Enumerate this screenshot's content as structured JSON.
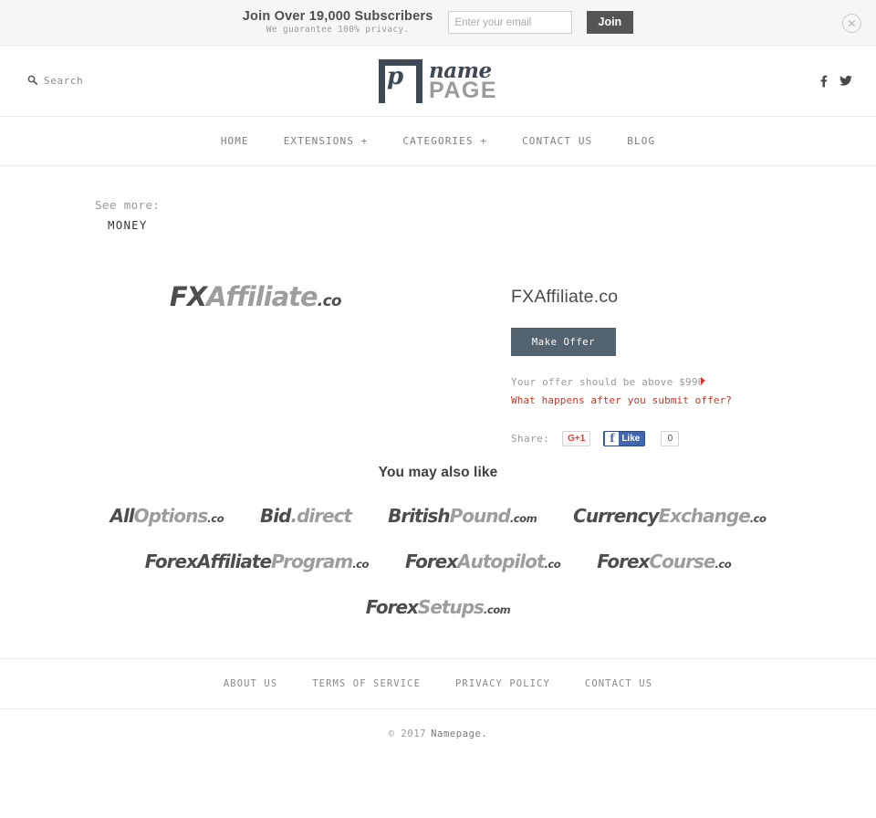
{
  "subscribe_bar": {
    "title": "Join Over 19,000 Subscribers",
    "subtitle": "We guarantee 100% privacy.",
    "email_placeholder": "Enter your email",
    "email_value": "",
    "join_label": "Join",
    "close_icon": "close-circle-icon"
  },
  "header": {
    "search_label": "Search",
    "search_icon": "search-icon",
    "logo_name": "name",
    "logo_page": "PAGE",
    "logo_mark_letter": "p",
    "social": [
      {
        "name": "facebook-icon",
        "label": "f"
      },
      {
        "name": "twitter-icon",
        "label": "t"
      }
    ]
  },
  "nav": {
    "items": [
      {
        "label": "HOME"
      },
      {
        "label": "EXTENSIONS +"
      },
      {
        "label": "CATEGORIES +"
      },
      {
        "label": "CONTACT US"
      },
      {
        "label": "BLOG"
      }
    ]
  },
  "breadcrumb": {
    "label": "See more:",
    "category": "MONEY"
  },
  "product": {
    "wordmark": {
      "part1": "FX",
      "part2": "Affiliate",
      "tld": ".co"
    },
    "title": "FXAffiliate.co",
    "make_offer_label": "Make Offer",
    "offer_note": "Your offer should be above $990",
    "minimum_offer": "$990",
    "offer_link": "What happens after you submit offer?",
    "share_label": "Share:",
    "gplus_label": "G+1",
    "fb_like_label": "Like",
    "fb_like_icon": "facebook-f-icon",
    "fb_count": "0"
  },
  "related": {
    "title": "You may also like",
    "rows": [
      [
        {
          "part1": "All",
          "part2": "Options",
          "tld": ".co"
        },
        {
          "part1": "Bid",
          "part2": ".direct",
          "tld": ""
        },
        {
          "part1": "British",
          "part2": "Pound",
          "tld": ".com"
        },
        {
          "part1": "Currency",
          "part2": "Exchange",
          "tld": ".co"
        }
      ],
      [
        {
          "part1": "ForexAffiliate",
          "part2": "Program",
          "tld": ".co"
        },
        {
          "part1": "Forex",
          "part2": "Autopilot",
          "tld": ".co"
        },
        {
          "part1": "Forex",
          "part2": "Course",
          "tld": ".co"
        }
      ],
      [
        {
          "part1": "Forex",
          "part2": "Setups",
          "tld": ".com"
        }
      ]
    ]
  },
  "footer": {
    "links": [
      {
        "label": "ABOUT US"
      },
      {
        "label": "TERMS OF SERVICE"
      },
      {
        "label": "PRIVACY POLICY"
      },
      {
        "label": "CONTACT US"
      }
    ],
    "copyright": "© 2017",
    "brand": "Namepage."
  },
  "colors": {
    "accent_button": "#53636f",
    "link_red": "#c0392b",
    "logo_dark": "#3d4a55",
    "facebook_blue": "#4267b2",
    "gplus_red": "#d34836"
  }
}
